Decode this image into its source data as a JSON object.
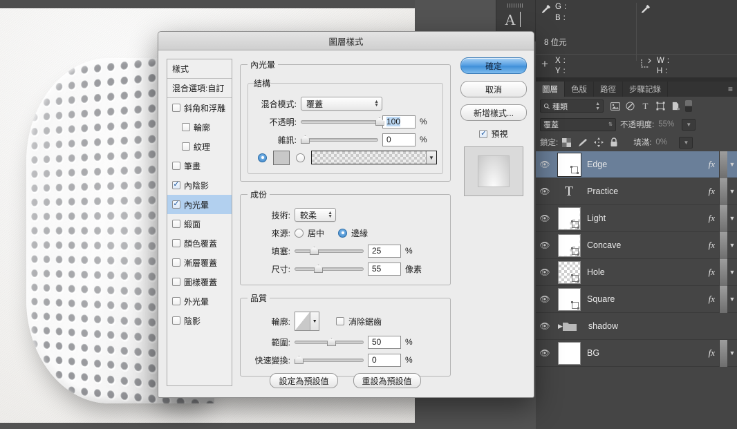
{
  "app": {
    "canvas_alt": "perforated-rounded-panel-artwork"
  },
  "dialog": {
    "title": "圖層樣式",
    "styles_column": {
      "header": "樣式",
      "blending_options": "混合選項:自訂",
      "effects": [
        {
          "label": "斜角和浮雕",
          "checked": false,
          "indent": false,
          "active": false
        },
        {
          "label": "輪廓",
          "checked": false,
          "indent": true,
          "active": false
        },
        {
          "label": "紋理",
          "checked": false,
          "indent": true,
          "active": false
        },
        {
          "label": "筆畫",
          "checked": false,
          "indent": false,
          "active": false
        },
        {
          "label": "內陰影",
          "checked": true,
          "indent": false,
          "active": false
        },
        {
          "label": "內光暈",
          "checked": true,
          "indent": false,
          "active": true
        },
        {
          "label": "緞面",
          "checked": false,
          "indent": false,
          "active": false
        },
        {
          "label": "顏色覆蓋",
          "checked": false,
          "indent": false,
          "active": false
        },
        {
          "label": "漸層覆蓋",
          "checked": false,
          "indent": false,
          "active": false
        },
        {
          "label": "圖樣覆蓋",
          "checked": false,
          "indent": false,
          "active": false
        },
        {
          "label": "外光暈",
          "checked": false,
          "indent": false,
          "active": false
        },
        {
          "label": "陰影",
          "checked": false,
          "indent": false,
          "active": false
        }
      ]
    },
    "buttons": {
      "ok": "確定",
      "cancel": "取消",
      "new_style": "新增樣式...",
      "preview_label": "預視",
      "preview_checked": true
    },
    "inner_glow": {
      "group_title": "內光暈",
      "structure": {
        "title": "結構",
        "blend_mode_label": "混合模式:",
        "blend_mode_value": "覆蓋",
        "opacity_label": "不透明:",
        "opacity_value": "100",
        "opacity_unit": "%",
        "noise_label": "雜訊:",
        "noise_value": "0",
        "noise_unit": "%",
        "color_radio_selected": true,
        "gradient_radio_selected": false
      },
      "elements": {
        "title": "成份",
        "technique_label": "技術:",
        "technique_value": "較柔",
        "source_label": "來源:",
        "source_center": "居中",
        "source_edge": "邊緣",
        "source_selected": "邊緣",
        "choke_label": "填塞:",
        "choke_value": "25",
        "choke_unit": "%",
        "size_label": "尺寸:",
        "size_value": "55",
        "size_unit": "像素"
      },
      "quality": {
        "title": "品質",
        "contour_label": "輪廓:",
        "antialias_label": "消除鋸齒",
        "antialias_checked": false,
        "range_label": "範圍:",
        "range_value": "50",
        "range_unit": "%",
        "jitter_label": "快速變換:",
        "jitter_value": "0",
        "jitter_unit": "%"
      },
      "footer": {
        "make_default": "設定為預設值",
        "reset_default": "重設為預設值"
      }
    }
  },
  "info_panel": {
    "g_label": "G :",
    "b_label": "B :",
    "bit_depth": "8 位元",
    "x_label": "X :",
    "y_label": "Y :",
    "w_label": "W :",
    "h_label": "H :"
  },
  "character_stub": {
    "glyph": "A"
  },
  "layers_panel": {
    "tabs": [
      {
        "label": "圖層",
        "active": true
      },
      {
        "label": "色版",
        "active": false
      },
      {
        "label": "路徑",
        "active": false
      },
      {
        "label": "步驟記錄",
        "active": false
      }
    ],
    "filter": {
      "kind_label": "種類",
      "icons": [
        "pixel-layer-icon",
        "adjustment-layer-icon",
        "type-layer-icon",
        "shape-layer-icon",
        "smart-object-icon"
      ]
    },
    "blend_mode": "覆蓋",
    "opacity_label": "不透明度:",
    "opacity_value": "55%",
    "lock_label": "鎖定:",
    "fill_label": "填滿:",
    "fill_value": "0%",
    "lock_icons": [
      "lock-transparency-icon",
      "lock-paint-icon",
      "lock-move-icon",
      "lock-all-icon"
    ],
    "layers": [
      {
        "name": "Edge",
        "visible": true,
        "fx": true,
        "selected": true,
        "type": "pixel",
        "thumb": "notch"
      },
      {
        "name": "Practice",
        "visible": true,
        "fx": true,
        "selected": false,
        "type": "text",
        "thumb": "T"
      },
      {
        "name": "Light",
        "visible": true,
        "fx": true,
        "selected": false,
        "type": "pixel",
        "thumb": "notch-checker"
      },
      {
        "name": "Concave",
        "visible": true,
        "fx": true,
        "selected": false,
        "type": "pixel",
        "thumb": "notch-checker"
      },
      {
        "name": "Hole",
        "visible": true,
        "fx": true,
        "selected": false,
        "type": "pixel",
        "thumb": "checker"
      },
      {
        "name": "Square",
        "visible": true,
        "fx": true,
        "selected": false,
        "type": "pixel",
        "thumb": "notch"
      },
      {
        "name": "shadow",
        "visible": true,
        "fx": false,
        "selected": false,
        "type": "group",
        "thumb": "folder"
      },
      {
        "name": "BG",
        "visible": true,
        "fx": true,
        "selected": false,
        "type": "pixel",
        "thumb": "white"
      }
    ]
  },
  "colors": {
    "accent_blue": "#4e9ae0",
    "selected_layer": "#6a7f99",
    "panel_dark": "#454545",
    "dialog_bg": "#ececec",
    "highlight_row": "#b2d0ef"
  }
}
